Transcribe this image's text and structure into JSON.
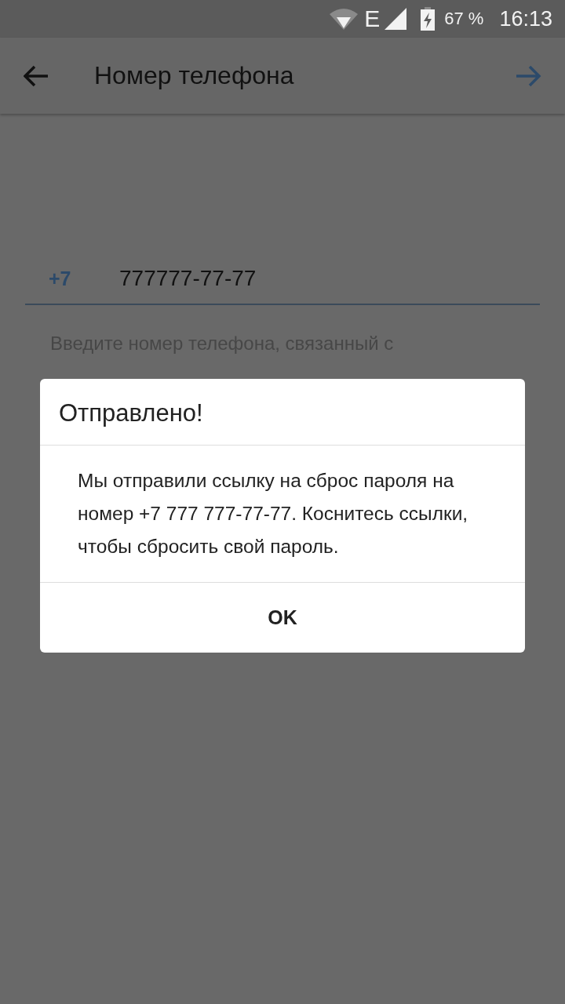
{
  "status_bar": {
    "network": "E",
    "battery": "67 %",
    "time": "16:13"
  },
  "app_bar": {
    "title": "Номер телефона"
  },
  "phone_field": {
    "country_code": "+7",
    "value": "777777-77-77"
  },
  "hint": "Введите номер телефона, связанный с",
  "dialog": {
    "title": "Отправлено!",
    "message": "Мы отправили ссылку на сброс пароля на номер +7 777 777-77-77. Коснитесь ссылки, чтобы сбросить свой пароль.",
    "buttons": [
      "OK"
    ]
  }
}
